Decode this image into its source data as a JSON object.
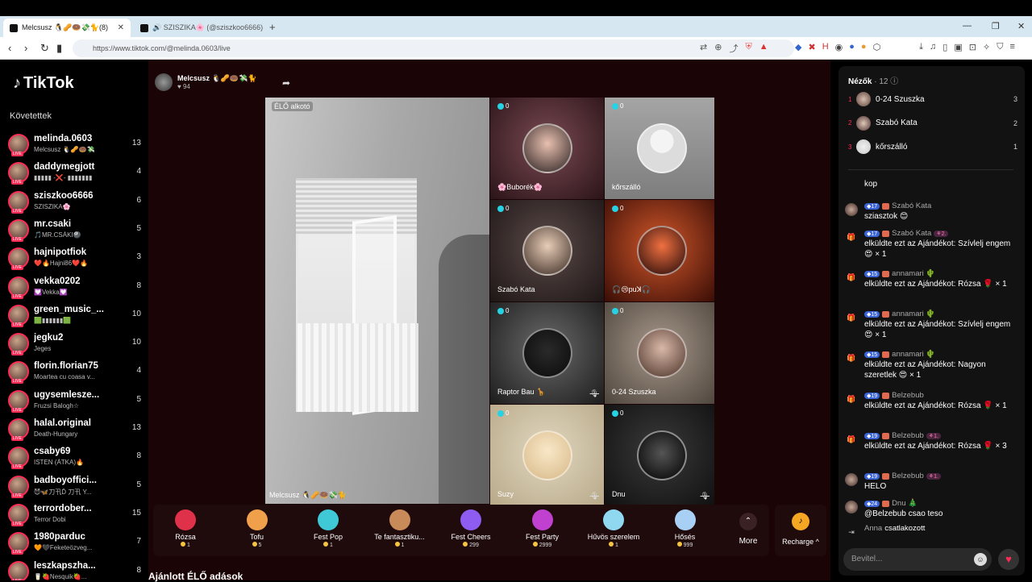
{
  "browser": {
    "tabs": [
      {
        "title": "Melcsusz 🐧🥜🍩💸🐈(8)",
        "active": true
      },
      {
        "title": "🔊 SZISZIKA🌸 (@sziszkoo6666) ÉLŐ",
        "active": false
      }
    ],
    "url": "https://www.tiktok.com/@melinda.0603/live"
  },
  "sidebar": {
    "logo": "TikTok",
    "following_label": "Követettek",
    "accounts": [
      {
        "name": "melinda.0603",
        "sub": "Melcsusz 🐧🥜🍩💸",
        "count": "13"
      },
      {
        "name": "daddymegjott",
        "sub": "▮▮▮▮▮ -❌- ▮▮▮▮▮▮▮",
        "count": "4"
      },
      {
        "name": "sziszkoo6666",
        "sub": "SZISZIKA🌸",
        "count": "6"
      },
      {
        "name": "mr.csaki",
        "sub": "🎵MR.CSÁKI🎱",
        "count": "5"
      },
      {
        "name": "hajnipotfiok",
        "sub": "❤️🔥Hajni86❤️🔥",
        "count": "3"
      },
      {
        "name": "vekka0202",
        "sub": "💟Vekka💟",
        "count": "8"
      },
      {
        "name": "green_music_...",
        "sub": "🟩▮▮▮▮▮▮🟩",
        "count": "10"
      },
      {
        "name": "jegku2",
        "sub": "Jeges",
        "count": "10"
      },
      {
        "name": "florin.florian75",
        "sub": "Moartea cu coasa v...",
        "count": "4"
      },
      {
        "name": "ugysemlesze...",
        "sub": "Fruzsi Balogh☆",
        "count": "5"
      },
      {
        "name": "halal.original",
        "sub": "Death-Hungary",
        "count": "13"
      },
      {
        "name": "csaby69",
        "sub": "ISTEN (ÁTKA)🔥",
        "count": "8"
      },
      {
        "name": "badboyoffici...",
        "sub": "😈🦋刀卂Ď 刀卂 Y...",
        "count": "5"
      },
      {
        "name": "terrordober...",
        "sub": "Terror Dobi",
        "count": "15"
      },
      {
        "name": "1980parduc",
        "sub": "🧡🖤Feketeözveg...",
        "count": "7"
      },
      {
        "name": "leszkapszha...",
        "sub": "🥛🍓Nesquik🍓...",
        "count": "8"
      }
    ]
  },
  "stage": {
    "host_name": "Melcsusz 🐧🥜🍩💸🐈",
    "host_likes": "♥ 94",
    "main_label": "ÉLŐ alkotó",
    "main_name": "Melcsusz 🐧🥜🍩💸🐈",
    "guests": [
      {
        "name": "🌸Buborék🌸",
        "score": "0",
        "muted": false
      },
      {
        "name": "kőrszálló",
        "score": "0",
        "muted": false
      },
      {
        "name": "Szabó Kata",
        "score": "0",
        "muted": false
      },
      {
        "name": "🎧😢puꓘ🎧",
        "score": "0",
        "muted": false
      },
      {
        "name": "Raptor Bau 🦒",
        "score": "0",
        "muted": true
      },
      {
        "name": "0-24 Szuszka",
        "score": "0",
        "muted": false
      },
      {
        "name": "Suzy",
        "score": "0",
        "muted": true
      },
      {
        "name": "Dnu",
        "score": "0",
        "muted": true
      }
    ],
    "gifts": [
      {
        "label": "Rózsa",
        "price": "1",
        "color": "#e0314a"
      },
      {
        "label": "Tofu",
        "price": "5",
        "color": "#f0a04b"
      },
      {
        "label": "Fest Pop",
        "price": "1",
        "color": "#3fc9d6"
      },
      {
        "label": "Te fantasztiku...",
        "price": "1",
        "color": "#c98a5a"
      },
      {
        "label": "Fest Cheers",
        "price": "299",
        "color": "#8e5cf0"
      },
      {
        "label": "Fest Party",
        "price": "2999",
        "color": "#c040d0"
      },
      {
        "label": "Hűvös szerelem",
        "price": "1",
        "color": "#8fd8f0"
      },
      {
        "label": "Hősés",
        "price": "999",
        "color": "#a8d0f5"
      }
    ],
    "more_label": "More",
    "recharge_label": "Recharge ^",
    "recommended_label": "Ajánlott ÉLŐ adások"
  },
  "panel": {
    "viewers_title": "Nézők",
    "viewers_count": "· 12",
    "top_viewers": [
      {
        "rank": "1",
        "name": "0-24 Szuszka",
        "score": "3"
      },
      {
        "rank": "2",
        "name": "Szabó Kata",
        "score": "2"
      },
      {
        "rank": "3",
        "name": "kőrszálló",
        "score": "1"
      }
    ],
    "chat": [
      {
        "type": "msg",
        "user": "",
        "level": "",
        "fan": "",
        "text": "kop"
      },
      {
        "type": "msg",
        "user": "Szabó Kata",
        "level": "17",
        "fan": "",
        "text": "sziasztok 😊"
      },
      {
        "type": "gift",
        "user": "Szabó Kata",
        "level": "17",
        "fan": "2.",
        "text": "elküldte ezt az Ajándékot: Szívlelj engem 😍 × 1"
      },
      {
        "type": "gift",
        "user": "annamari 🌵",
        "level": "15",
        "fan": "",
        "text": "elküldte ezt az Ajándékot: Rózsa 🌹 × 1"
      },
      {
        "type": "gift",
        "user": "annamari 🌵",
        "level": "15",
        "fan": "",
        "text": "elküldte ezt az Ajándékot: Szívlelj engem 😍 × 1"
      },
      {
        "type": "gift",
        "user": "annamari 🌵",
        "level": "15",
        "fan": "",
        "text": "elküldte ezt az Ajándékot: Nagyon szeretlek 😍 × 1"
      },
      {
        "type": "gift",
        "user": "Belzebub",
        "level": "19",
        "fan": "",
        "text": "elküldte ezt az Ajándékot: Rózsa 🌹 × 1"
      },
      {
        "type": "gift",
        "user": "Belzebub",
        "level": "19",
        "fan": "1.",
        "text": "elküldte ezt az Ajándékot: Rózsa 🌹 × 3"
      },
      {
        "type": "msg",
        "user": "Belzebub",
        "level": "19",
        "fan": "1.",
        "text": "HELO"
      },
      {
        "type": "msg",
        "user": "Dnu 🎄",
        "level": "24",
        "fan": "",
        "text": "@Belzebub csao teso"
      },
      {
        "type": "join",
        "user": "Anna",
        "level": "",
        "fan": "",
        "text": "csatlakozott"
      }
    ],
    "input_placeholder": "Bevitel..."
  }
}
